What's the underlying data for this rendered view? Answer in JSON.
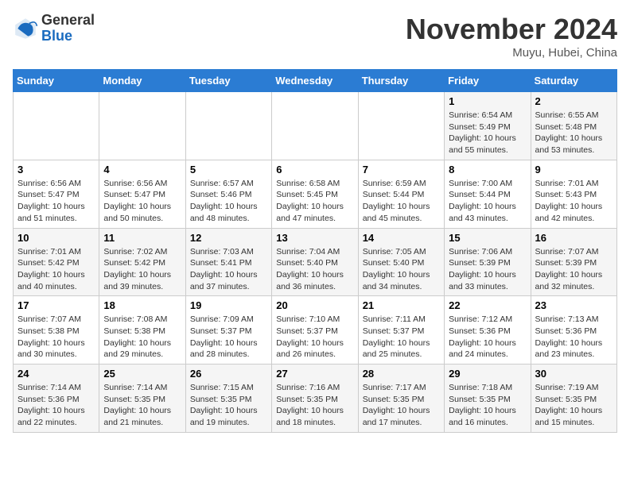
{
  "header": {
    "logo_general": "General",
    "logo_blue": "Blue",
    "month_title": "November 2024",
    "subtitle": "Muyu, Hubei, China"
  },
  "calendar": {
    "days_of_week": [
      "Sunday",
      "Monday",
      "Tuesday",
      "Wednesday",
      "Thursday",
      "Friday",
      "Saturday"
    ],
    "weeks": [
      [
        {
          "day": "",
          "info": ""
        },
        {
          "day": "",
          "info": ""
        },
        {
          "day": "",
          "info": ""
        },
        {
          "day": "",
          "info": ""
        },
        {
          "day": "",
          "info": ""
        },
        {
          "day": "1",
          "info": "Sunrise: 6:54 AM\nSunset: 5:49 PM\nDaylight: 10 hours and 55 minutes."
        },
        {
          "day": "2",
          "info": "Sunrise: 6:55 AM\nSunset: 5:48 PM\nDaylight: 10 hours and 53 minutes."
        }
      ],
      [
        {
          "day": "3",
          "info": "Sunrise: 6:56 AM\nSunset: 5:47 PM\nDaylight: 10 hours and 51 minutes."
        },
        {
          "day": "4",
          "info": "Sunrise: 6:56 AM\nSunset: 5:47 PM\nDaylight: 10 hours and 50 minutes."
        },
        {
          "day": "5",
          "info": "Sunrise: 6:57 AM\nSunset: 5:46 PM\nDaylight: 10 hours and 48 minutes."
        },
        {
          "day": "6",
          "info": "Sunrise: 6:58 AM\nSunset: 5:45 PM\nDaylight: 10 hours and 47 minutes."
        },
        {
          "day": "7",
          "info": "Sunrise: 6:59 AM\nSunset: 5:44 PM\nDaylight: 10 hours and 45 minutes."
        },
        {
          "day": "8",
          "info": "Sunrise: 7:00 AM\nSunset: 5:44 PM\nDaylight: 10 hours and 43 minutes."
        },
        {
          "day": "9",
          "info": "Sunrise: 7:01 AM\nSunset: 5:43 PM\nDaylight: 10 hours and 42 minutes."
        }
      ],
      [
        {
          "day": "10",
          "info": "Sunrise: 7:01 AM\nSunset: 5:42 PM\nDaylight: 10 hours and 40 minutes."
        },
        {
          "day": "11",
          "info": "Sunrise: 7:02 AM\nSunset: 5:42 PM\nDaylight: 10 hours and 39 minutes."
        },
        {
          "day": "12",
          "info": "Sunrise: 7:03 AM\nSunset: 5:41 PM\nDaylight: 10 hours and 37 minutes."
        },
        {
          "day": "13",
          "info": "Sunrise: 7:04 AM\nSunset: 5:40 PM\nDaylight: 10 hours and 36 minutes."
        },
        {
          "day": "14",
          "info": "Sunrise: 7:05 AM\nSunset: 5:40 PM\nDaylight: 10 hours and 34 minutes."
        },
        {
          "day": "15",
          "info": "Sunrise: 7:06 AM\nSunset: 5:39 PM\nDaylight: 10 hours and 33 minutes."
        },
        {
          "day": "16",
          "info": "Sunrise: 7:07 AM\nSunset: 5:39 PM\nDaylight: 10 hours and 32 minutes."
        }
      ],
      [
        {
          "day": "17",
          "info": "Sunrise: 7:07 AM\nSunset: 5:38 PM\nDaylight: 10 hours and 30 minutes."
        },
        {
          "day": "18",
          "info": "Sunrise: 7:08 AM\nSunset: 5:38 PM\nDaylight: 10 hours and 29 minutes."
        },
        {
          "day": "19",
          "info": "Sunrise: 7:09 AM\nSunset: 5:37 PM\nDaylight: 10 hours and 28 minutes."
        },
        {
          "day": "20",
          "info": "Sunrise: 7:10 AM\nSunset: 5:37 PM\nDaylight: 10 hours and 26 minutes."
        },
        {
          "day": "21",
          "info": "Sunrise: 7:11 AM\nSunset: 5:37 PM\nDaylight: 10 hours and 25 minutes."
        },
        {
          "day": "22",
          "info": "Sunrise: 7:12 AM\nSunset: 5:36 PM\nDaylight: 10 hours and 24 minutes."
        },
        {
          "day": "23",
          "info": "Sunrise: 7:13 AM\nSunset: 5:36 PM\nDaylight: 10 hours and 23 minutes."
        }
      ],
      [
        {
          "day": "24",
          "info": "Sunrise: 7:14 AM\nSunset: 5:36 PM\nDaylight: 10 hours and 22 minutes."
        },
        {
          "day": "25",
          "info": "Sunrise: 7:14 AM\nSunset: 5:35 PM\nDaylight: 10 hours and 21 minutes."
        },
        {
          "day": "26",
          "info": "Sunrise: 7:15 AM\nSunset: 5:35 PM\nDaylight: 10 hours and 19 minutes."
        },
        {
          "day": "27",
          "info": "Sunrise: 7:16 AM\nSunset: 5:35 PM\nDaylight: 10 hours and 18 minutes."
        },
        {
          "day": "28",
          "info": "Sunrise: 7:17 AM\nSunset: 5:35 PM\nDaylight: 10 hours and 17 minutes."
        },
        {
          "day": "29",
          "info": "Sunrise: 7:18 AM\nSunset: 5:35 PM\nDaylight: 10 hours and 16 minutes."
        },
        {
          "day": "30",
          "info": "Sunrise: 7:19 AM\nSunset: 5:35 PM\nDaylight: 10 hours and 15 minutes."
        }
      ]
    ]
  }
}
